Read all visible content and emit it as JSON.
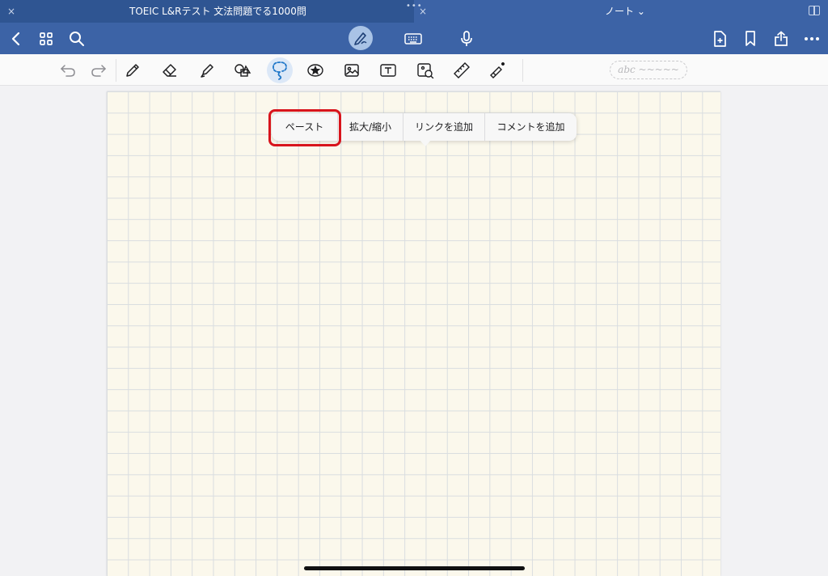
{
  "tabs": {
    "left_title": "TOEIC L&Rテスト 文法問題でる1000問",
    "right_title": "ノート ⌄",
    "close_glyph": "×"
  },
  "navbar": {
    "icons": [
      "back-icon",
      "grid-icon",
      "search-icon",
      "pen-mode-icon",
      "keyboard-icon",
      "microphone-icon",
      "add-page-icon",
      "bookmark-icon",
      "share-icon",
      "more-icon"
    ]
  },
  "toolbar": {
    "tools": [
      "undo-icon",
      "redo-icon",
      "pen-icon",
      "eraser-icon",
      "highlighter-icon",
      "shapes-icon",
      "lasso-icon",
      "sticker-icon",
      "image-icon",
      "textbox-icon",
      "camera-icon",
      "ruler-icon",
      "laser-pointer-icon"
    ],
    "handwriting_placeholder": "abc ~~~~~",
    "active_tool": "lasso-icon"
  },
  "context_menu": {
    "items": [
      "ペースト",
      "拡大/縮小",
      "リンクを追加",
      "コメントを追加"
    ],
    "highlighted_index": 0
  },
  "colors": {
    "header_blue": "#3c63a6",
    "active_tab_blue": "#2f5592",
    "paper": "#fbf8ec",
    "highlight_red": "#d8141c",
    "accent": "#1f77c9"
  }
}
